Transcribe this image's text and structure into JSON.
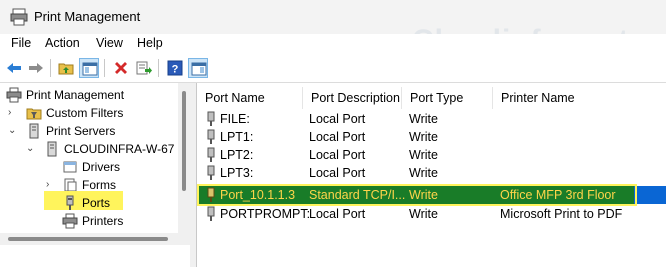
{
  "window": {
    "title": "Print Management"
  },
  "watermark": "Cloudinfra.net",
  "menu": {
    "file": "File",
    "action": "Action",
    "view": "View",
    "help": "Help"
  },
  "toolbar": {
    "buttons": [
      "back-arrow-icon",
      "forward-arrow-icon",
      "up-folder-icon",
      "show-hide-tree-icon",
      "delete-icon",
      "export-list-icon",
      "help-icon",
      "show-hide-action-pane-icon"
    ]
  },
  "tree": {
    "root": "Print Management",
    "custom_filters": "Custom Filters",
    "print_servers": "Print Servers",
    "server": "CLOUDINFRA-W-67",
    "drivers": "Drivers",
    "forms": "Forms",
    "ports": "Ports",
    "printers": "Printers"
  },
  "columns": {
    "port_name": "Port Name",
    "port_description": "Port Description",
    "port_type": "Port Type",
    "printer_name": "Printer Name"
  },
  "rows": [
    {
      "name": "FILE:",
      "description": "Local Port",
      "type": "Write",
      "printer": ""
    },
    {
      "name": "LPT1:",
      "description": "Local Port",
      "type": "Write",
      "printer": ""
    },
    {
      "name": "LPT2:",
      "description": "Local Port",
      "type": "Write",
      "printer": ""
    },
    {
      "name": "LPT3:",
      "description": "Local Port",
      "type": "Write",
      "printer": ""
    },
    {
      "name": "Port_10.1.1.3",
      "description": "Standard TCP/I...",
      "type": "Write",
      "printer": "Office MFP 3rd Floor"
    },
    {
      "name": "PORTPROMPT:",
      "description": "Local Port",
      "type": "Write",
      "printer": "Microsoft Print to PDF"
    }
  ],
  "colors": {
    "highlight_row": "#197c28",
    "highlight_text": "#ffd54a",
    "yellow_marker": "#fff45c",
    "selection_blue": "#0a66d4"
  }
}
